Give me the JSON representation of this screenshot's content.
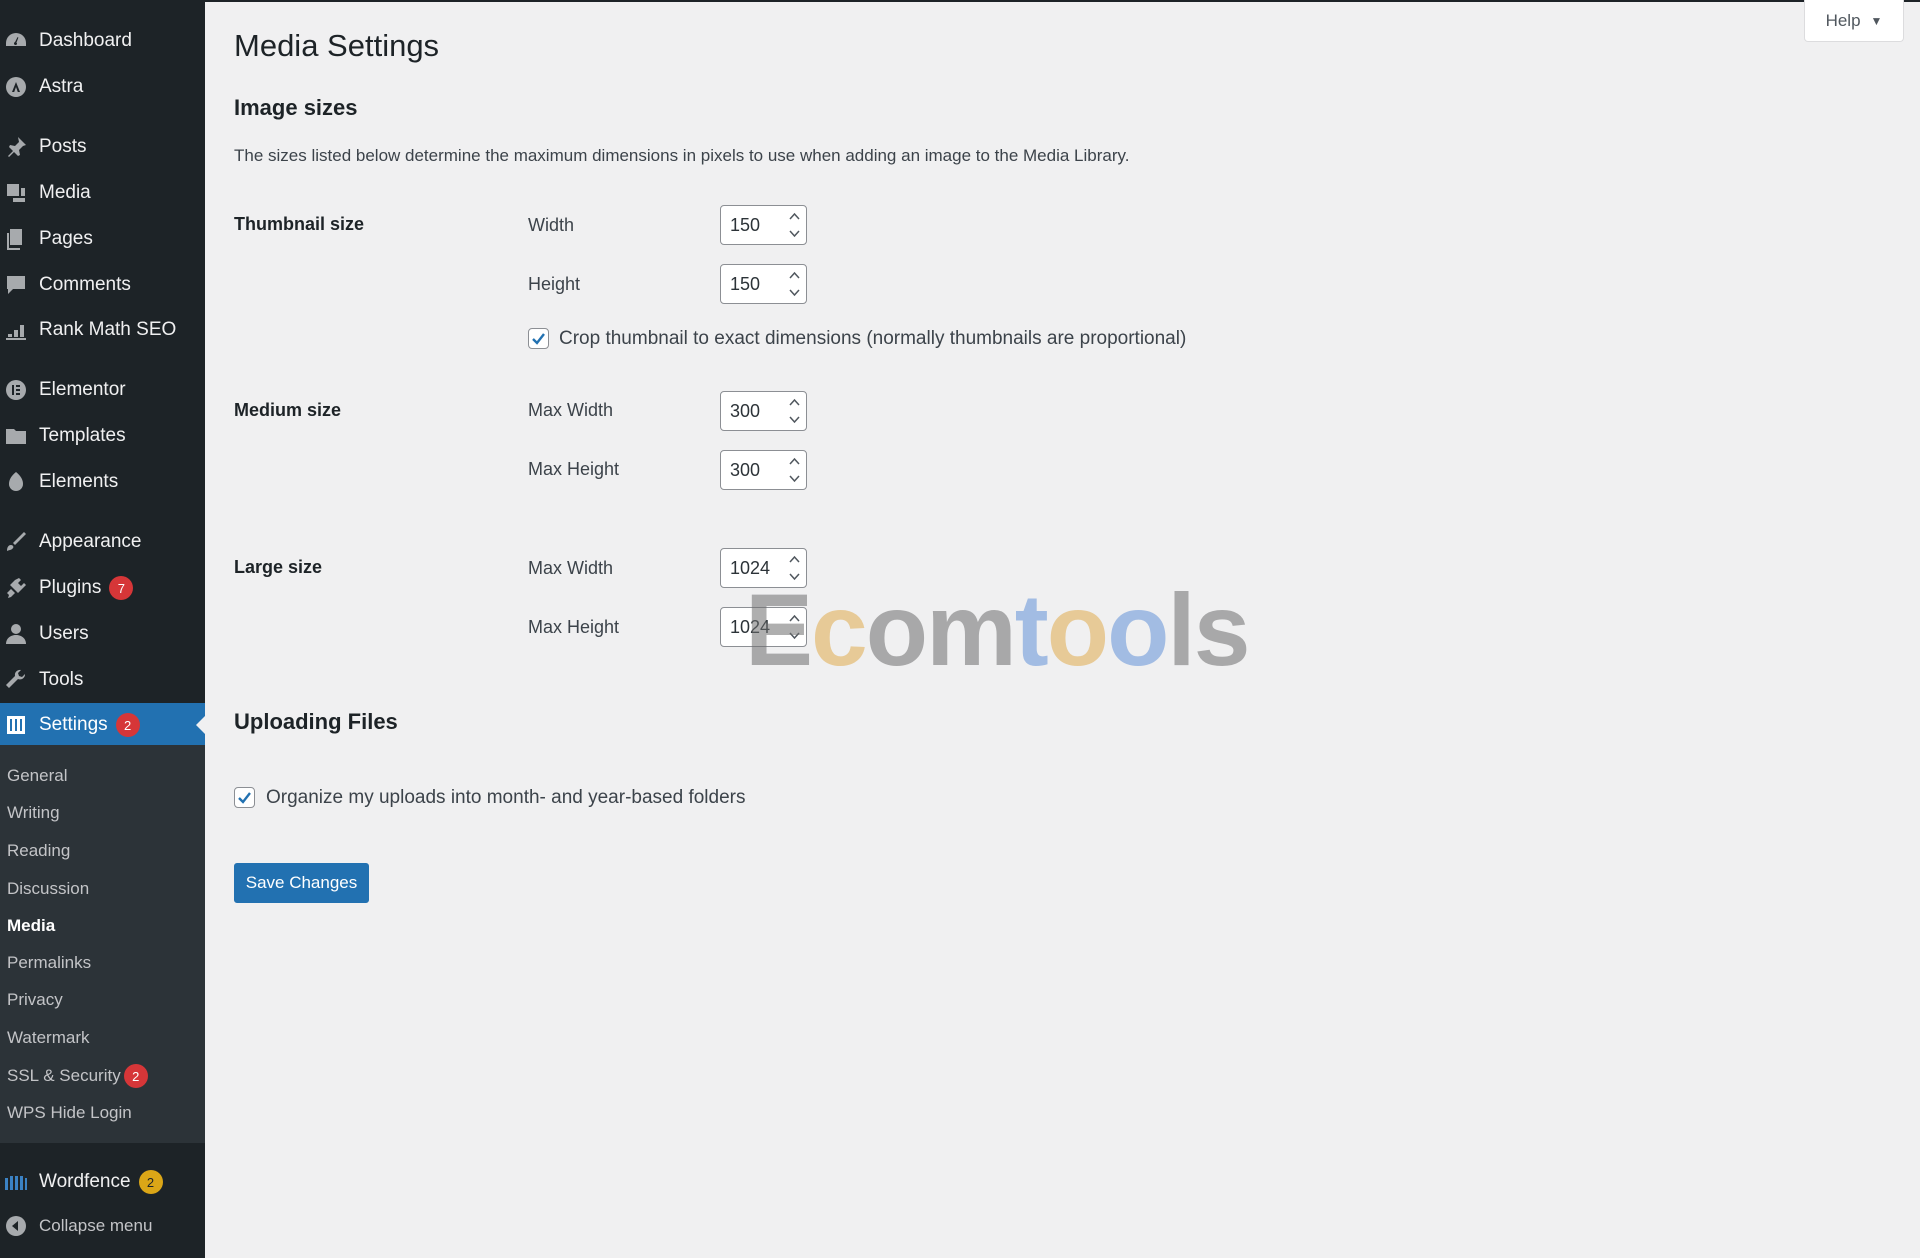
{
  "sidebar": {
    "items": [
      {
        "label": "Dashboard",
        "icon": "dashboard-icon"
      },
      {
        "label": "Astra",
        "icon": "astra-icon"
      },
      {
        "label": "Posts",
        "icon": "pin-icon"
      },
      {
        "label": "Media",
        "icon": "media-icon"
      },
      {
        "label": "Pages",
        "icon": "pages-icon"
      },
      {
        "label": "Comments",
        "icon": "comment-icon"
      },
      {
        "label": "Rank Math SEO",
        "icon": "chart-icon"
      },
      {
        "label": "Elementor",
        "icon": "elementor-icon"
      },
      {
        "label": "Templates",
        "icon": "folder-icon"
      },
      {
        "label": "Elements",
        "icon": "elements-icon"
      },
      {
        "label": "Appearance",
        "icon": "brush-icon"
      },
      {
        "label": "Plugins",
        "icon": "plug-icon",
        "badge": "7"
      },
      {
        "label": "Users",
        "icon": "user-icon"
      },
      {
        "label": "Tools",
        "icon": "wrench-icon"
      },
      {
        "label": "Settings",
        "icon": "settings-icon",
        "badge": "2"
      },
      {
        "label": "Wordfence",
        "icon": "wordfence-icon",
        "badge": "2"
      },
      {
        "label": "Collapse menu",
        "icon": "collapse-icon"
      }
    ],
    "submenu": [
      {
        "label": "General"
      },
      {
        "label": "Writing"
      },
      {
        "label": "Reading"
      },
      {
        "label": "Discussion"
      },
      {
        "label": "Media"
      },
      {
        "label": "Permalinks"
      },
      {
        "label": "Privacy"
      },
      {
        "label": "Watermark"
      },
      {
        "label": "SSL & Security",
        "badge": "2"
      },
      {
        "label": "WPS Hide Login"
      }
    ]
  },
  "help": {
    "label": "Help"
  },
  "page": {
    "title": "Media Settings",
    "image_sizes": {
      "title": "Image sizes",
      "description": "The sizes listed below determine the maximum dimensions in pixels to use when adding an image to the Media Library.",
      "thumbnail": {
        "label": "Thumbnail size",
        "width_label": "Width",
        "width_value": "150",
        "height_label": "Height",
        "height_value": "150",
        "crop_label": "Crop thumbnail to exact dimensions (normally thumbnails are proportional)",
        "crop_checked": true
      },
      "medium": {
        "label": "Medium size",
        "width_label": "Max Width",
        "width_value": "300",
        "height_label": "Max Height",
        "height_value": "300"
      },
      "large": {
        "label": "Large size",
        "width_label": "Max Width",
        "width_value": "1024",
        "height_label": "Max Height",
        "height_value": "1024"
      }
    },
    "uploading": {
      "title": "Uploading Files",
      "organize_label": "Organize my uploads into month- and year-based folders",
      "organize_checked": true
    },
    "save_label": "Save Changes"
  },
  "watermark": {
    "text": "Ecomtools"
  },
  "colors": {
    "accent": "#2271b1",
    "sidebar_bg": "#1d2327",
    "badge_red": "#d63638",
    "badge_amber": "#dba617"
  }
}
